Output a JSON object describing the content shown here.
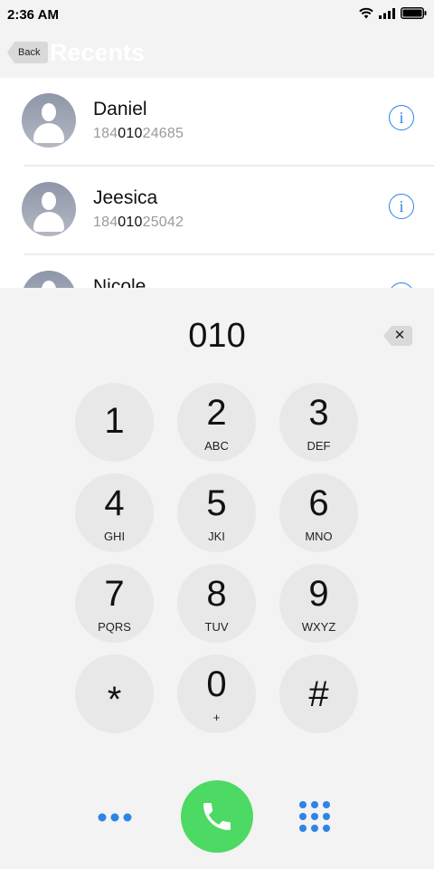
{
  "status": {
    "time": "2:36 AM"
  },
  "header": {
    "back_label": "Back",
    "title": "Recents"
  },
  "recents": [
    {
      "name": "Daniel",
      "number_prefix": "184",
      "number_match": "010",
      "number_suffix": "24685"
    },
    {
      "name": "Jeesica",
      "number_prefix": "184",
      "number_match": "010",
      "number_suffix": "25042"
    },
    {
      "name": "Nicole",
      "number_prefix": "",
      "number_match": "",
      "number_suffix": ""
    }
  ],
  "info_glyph": "i",
  "dialer": {
    "display": "010",
    "delete_glyph": "✕",
    "keys": [
      {
        "digit": "1",
        "letters": ""
      },
      {
        "digit": "2",
        "letters": "ABC"
      },
      {
        "digit": "3",
        "letters": "DEF"
      },
      {
        "digit": "4",
        "letters": "GHI"
      },
      {
        "digit": "5",
        "letters": "JKI"
      },
      {
        "digit": "6",
        "letters": "MNO"
      },
      {
        "digit": "7",
        "letters": "PQRS"
      },
      {
        "digit": "8",
        "letters": "TUV"
      },
      {
        "digit": "9",
        "letters": "WXYZ"
      },
      {
        "digit": "*",
        "letters": ""
      },
      {
        "digit": "0",
        "letters": "+"
      },
      {
        "digit": "#",
        "letters": ""
      }
    ]
  },
  "colors": {
    "accent": "#2e84e6",
    "call": "#4cd964",
    "key_bg": "#e8e8e8"
  },
  "icons": {
    "more": "more-dots-icon",
    "call": "phone-icon",
    "keypad": "keypad-grid-icon"
  }
}
